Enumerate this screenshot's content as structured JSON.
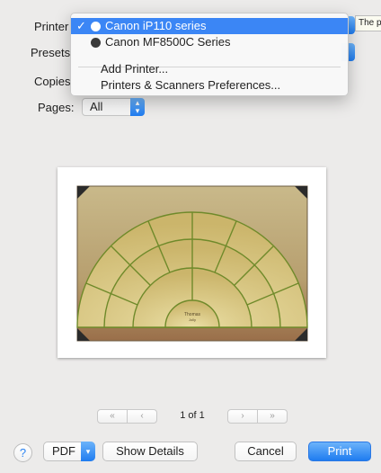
{
  "labels": {
    "printer": "Printer",
    "presets": "Presets",
    "copies": "Copies",
    "pages": "Pages:"
  },
  "printer_menu": {
    "items": [
      {
        "label": "Canon iP110 series",
        "checked": true,
        "selected": true
      },
      {
        "label": "Canon MF8500C Series",
        "checked": false,
        "selected": false
      }
    ],
    "add_printer": "Add Printer...",
    "preferences": "Printers & Scanners Preferences..."
  },
  "tooltip": "The p",
  "pages_select": {
    "value": "All"
  },
  "preview": {
    "center_name": "Thomas",
    "center_sub": "Jolly",
    "page_indicator": "1 of 1"
  },
  "buttons": {
    "help": "?",
    "pdf": "PDF",
    "show_details": "Show Details",
    "cancel": "Cancel",
    "print": "Print"
  },
  "colors": {
    "accent": "#2a83f2",
    "menu_highlight": "#3b86f5"
  }
}
